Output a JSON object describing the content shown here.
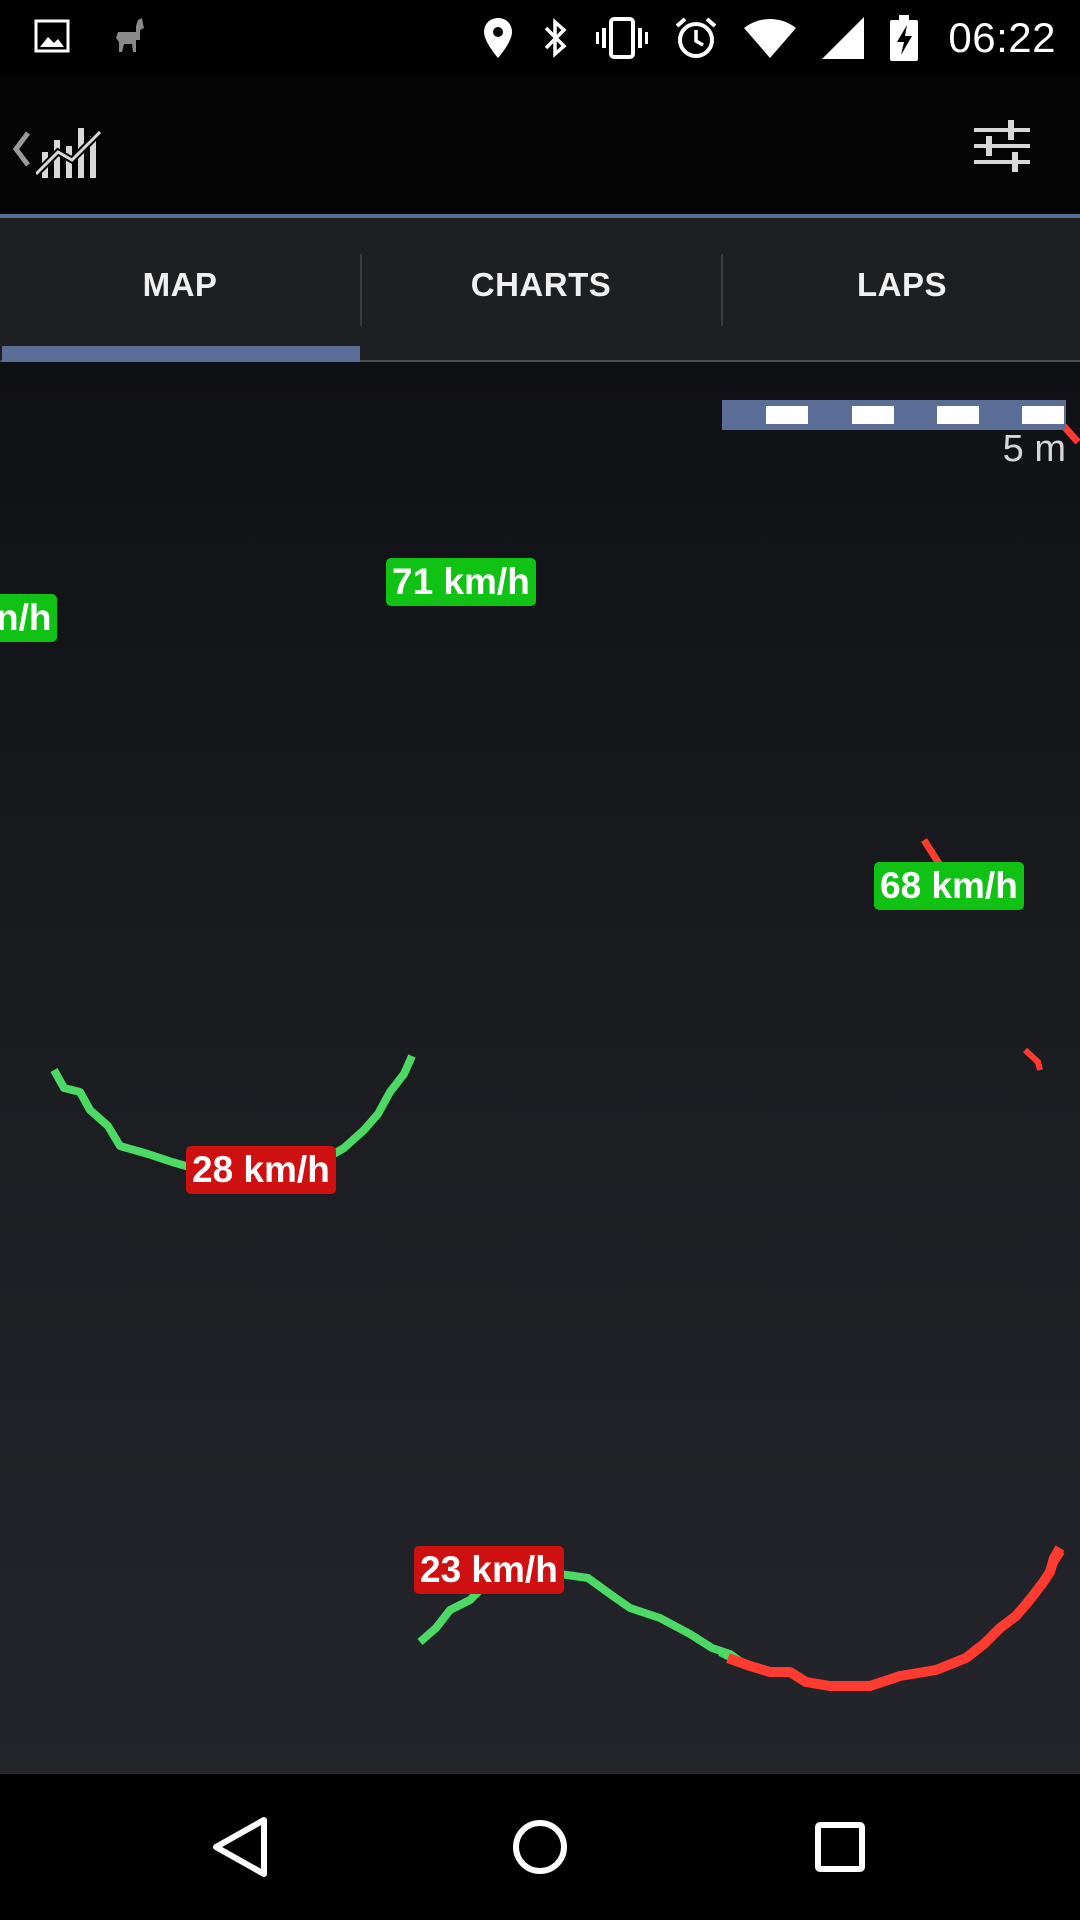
{
  "status_bar": {
    "time": "06:22",
    "icons": [
      "image-icon",
      "llama-icon",
      "location-icon",
      "bluetooth-icon",
      "vibrate-icon",
      "alarm-icon",
      "wifi-icon",
      "signal-icon",
      "battery-charging-icon"
    ]
  },
  "app_bar": {
    "back_icon": "chevron-left-icon",
    "app_icon": "chart-bars-icon",
    "settings_icon": "sliders-icon"
  },
  "tabs": [
    {
      "label": "MAP",
      "selected": true
    },
    {
      "label": "CHARTS",
      "selected": false
    },
    {
      "label": "LAPS",
      "selected": false
    }
  ],
  "map": {
    "scale_label": "5 m",
    "speed_labels": [
      {
        "text": "n/h",
        "level": "fast"
      },
      {
        "text": "71 km/h",
        "level": "fast"
      },
      {
        "text": "68 km/h",
        "level": "fast"
      },
      {
        "text": "28 km/h",
        "level": "slow"
      },
      {
        "text": "23 km/h",
        "level": "slow"
      }
    ],
    "colors": {
      "fast": "#10c214",
      "slow": "#cf1010",
      "track_fast": "#4cd964",
      "track_slow": "#ff3b30",
      "accent": "#5a6d96"
    }
  },
  "nav_bar": {
    "back_icon": "triangle-back-icon",
    "home_icon": "circle-home-icon",
    "recents_icon": "square-recents-icon"
  }
}
